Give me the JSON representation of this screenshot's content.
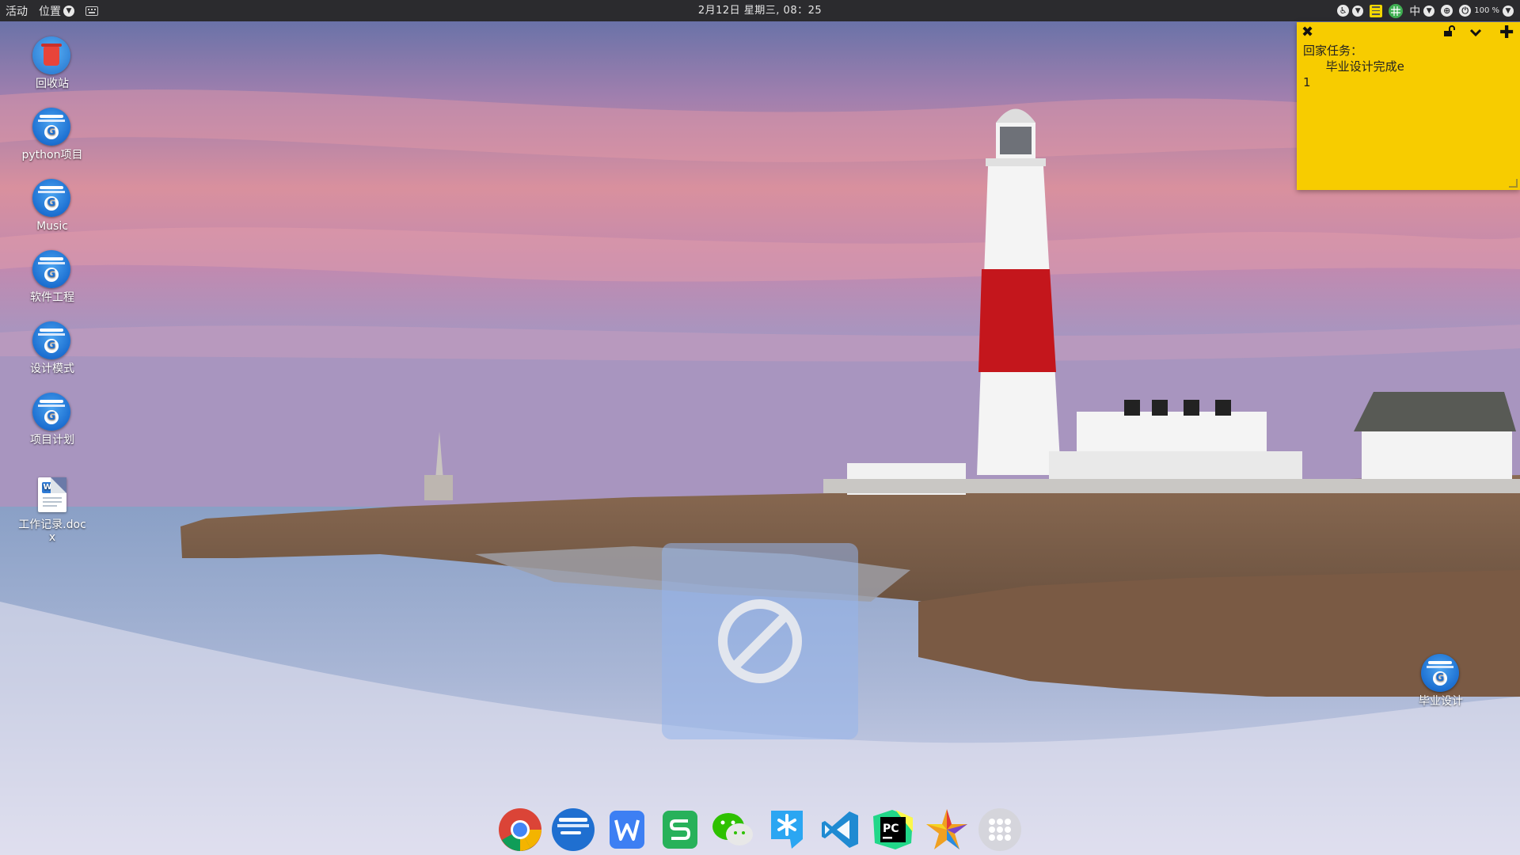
{
  "topbar": {
    "activities": "活动",
    "places": "位置",
    "datetime": "2月12日 星期三, 08：25",
    "input_method": "中",
    "battery": "100 %"
  },
  "desktop": {
    "icons": [
      {
        "label": "回收站",
        "icon": "trash-icon"
      },
      {
        "label": "python项目",
        "icon": "folder-icon"
      },
      {
        "label": "Music",
        "icon": "folder-icon"
      },
      {
        "label": "软件工程",
        "icon": "folder-icon"
      },
      {
        "label": "设计模式",
        "icon": "folder-icon"
      },
      {
        "label": "项目计划",
        "icon": "folder-icon"
      },
      {
        "label": "工作记录.docx",
        "icon": "word-document-icon"
      },
      {
        "label": "毕业设计",
        "icon": "folder-icon"
      }
    ]
  },
  "sticky_note": {
    "content": "回家任务：\n      毕业设计完成e\n1",
    "color": "#f7cc00"
  },
  "dock": {
    "apps": [
      {
        "icon": "chrome-icon"
      },
      {
        "icon": "file-manager-icon"
      },
      {
        "icon": "wps-writer-icon"
      },
      {
        "icon": "wps-spreadsheet-icon"
      },
      {
        "icon": "wechat-icon"
      },
      {
        "icon": "feishu-icon"
      },
      {
        "icon": "vscode-icon"
      },
      {
        "icon": "pycharm-icon"
      },
      {
        "icon": "star-app-icon"
      },
      {
        "icon": "show-applications-icon"
      }
    ]
  },
  "colors": {
    "topbar_bg": "#2b2b2e",
    "folder_blue": "#1c6fd1",
    "sticky_yellow": "#f7cc00"
  }
}
